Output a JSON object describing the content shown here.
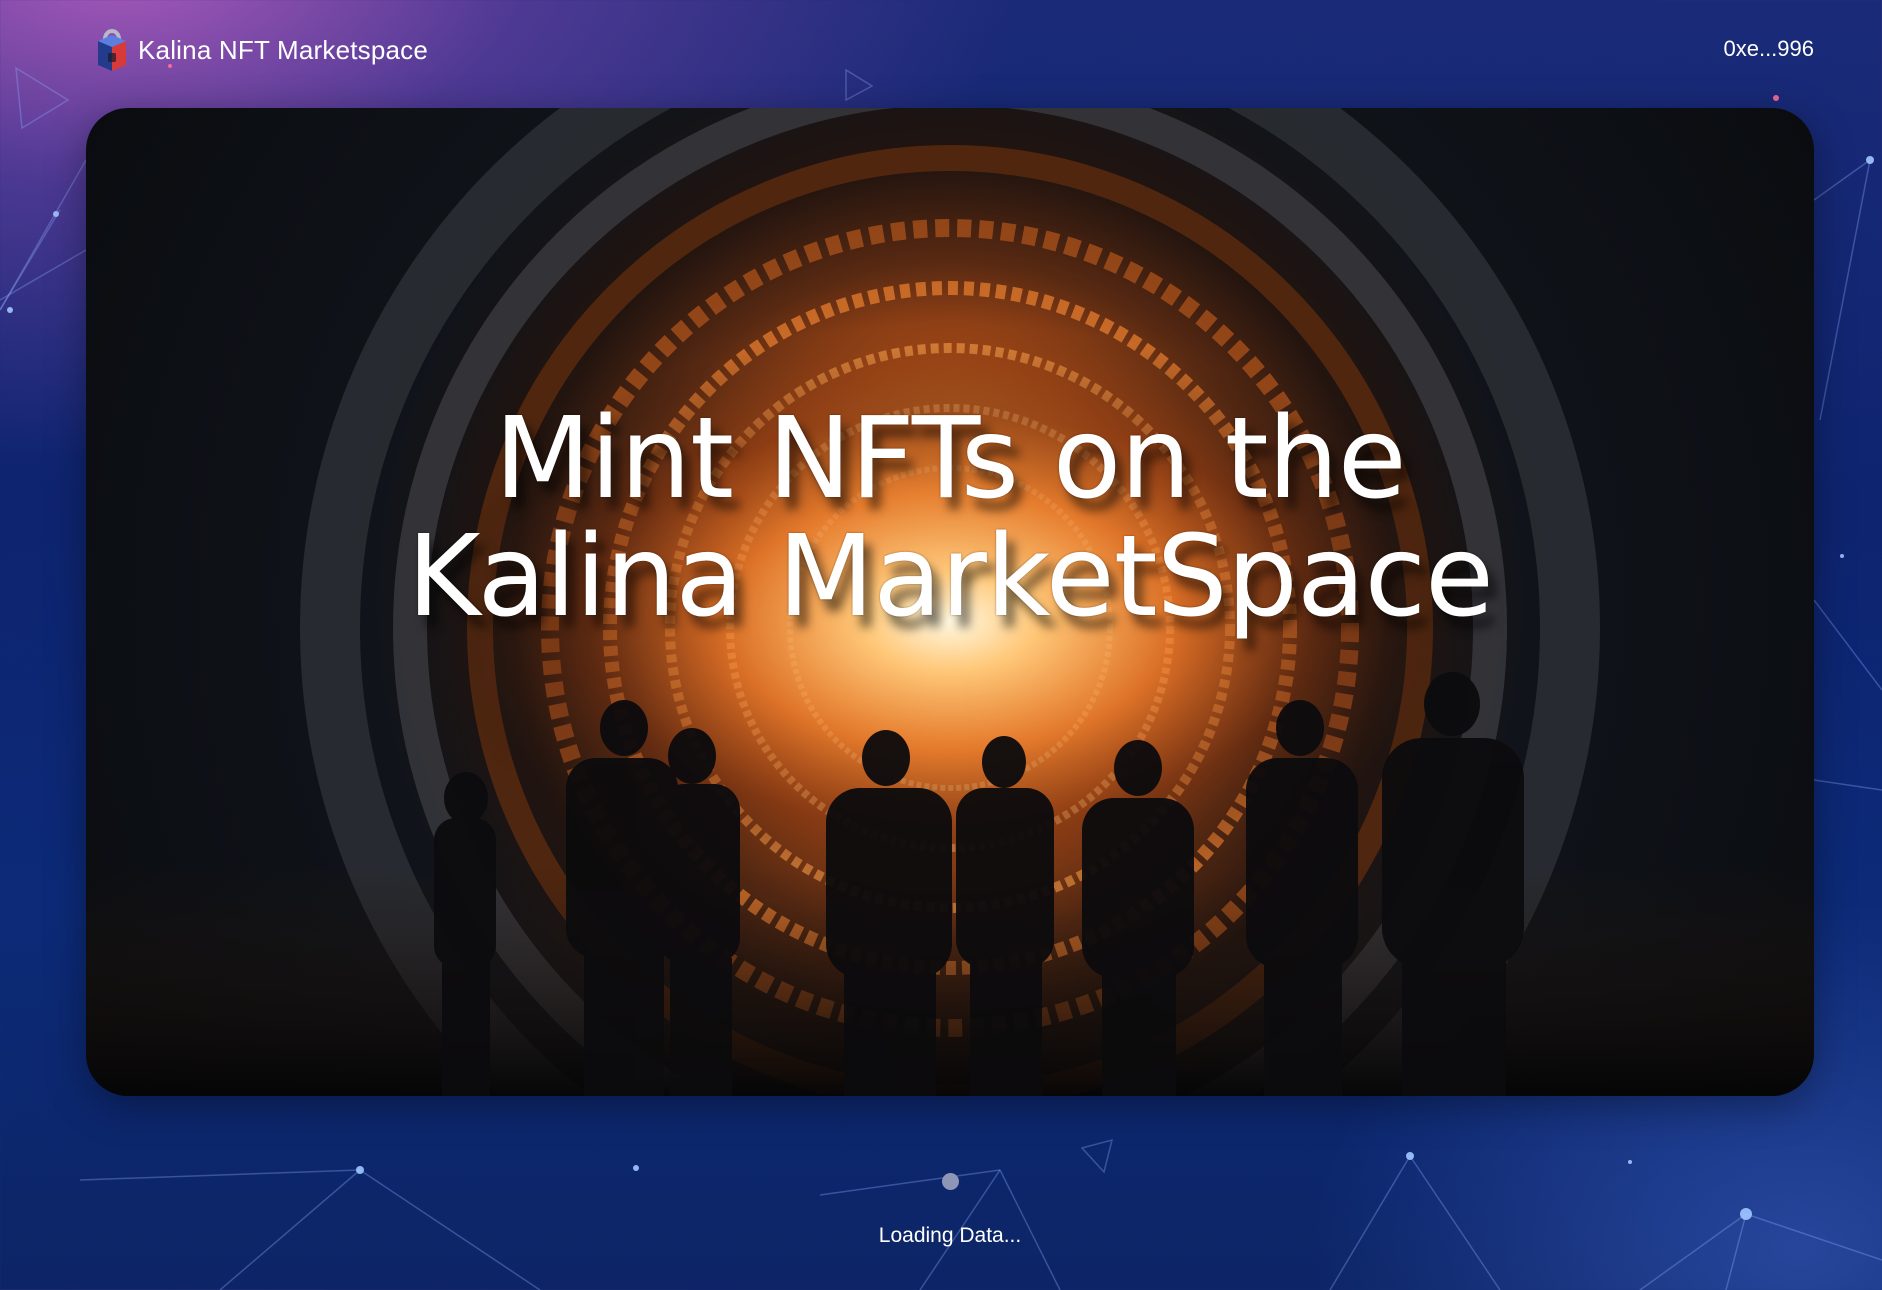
{
  "header": {
    "brand_name": "Kalina NFT Marketspace",
    "logo_icon": "shield-lock-logo",
    "wallet_address": "0xe...996"
  },
  "hero": {
    "title_line1": "Mint NFTs on the",
    "title_line2": "Kalina MarketSpace",
    "image_description_icon": "portal-tunnel-illustration"
  },
  "status": {
    "loading_text": "Loading Data..."
  },
  "colors": {
    "background_top_left": "#b25cbe",
    "background_main": "#0e2470",
    "accent_glow": "#f08a32",
    "loader_dot": "#8e96b8"
  }
}
